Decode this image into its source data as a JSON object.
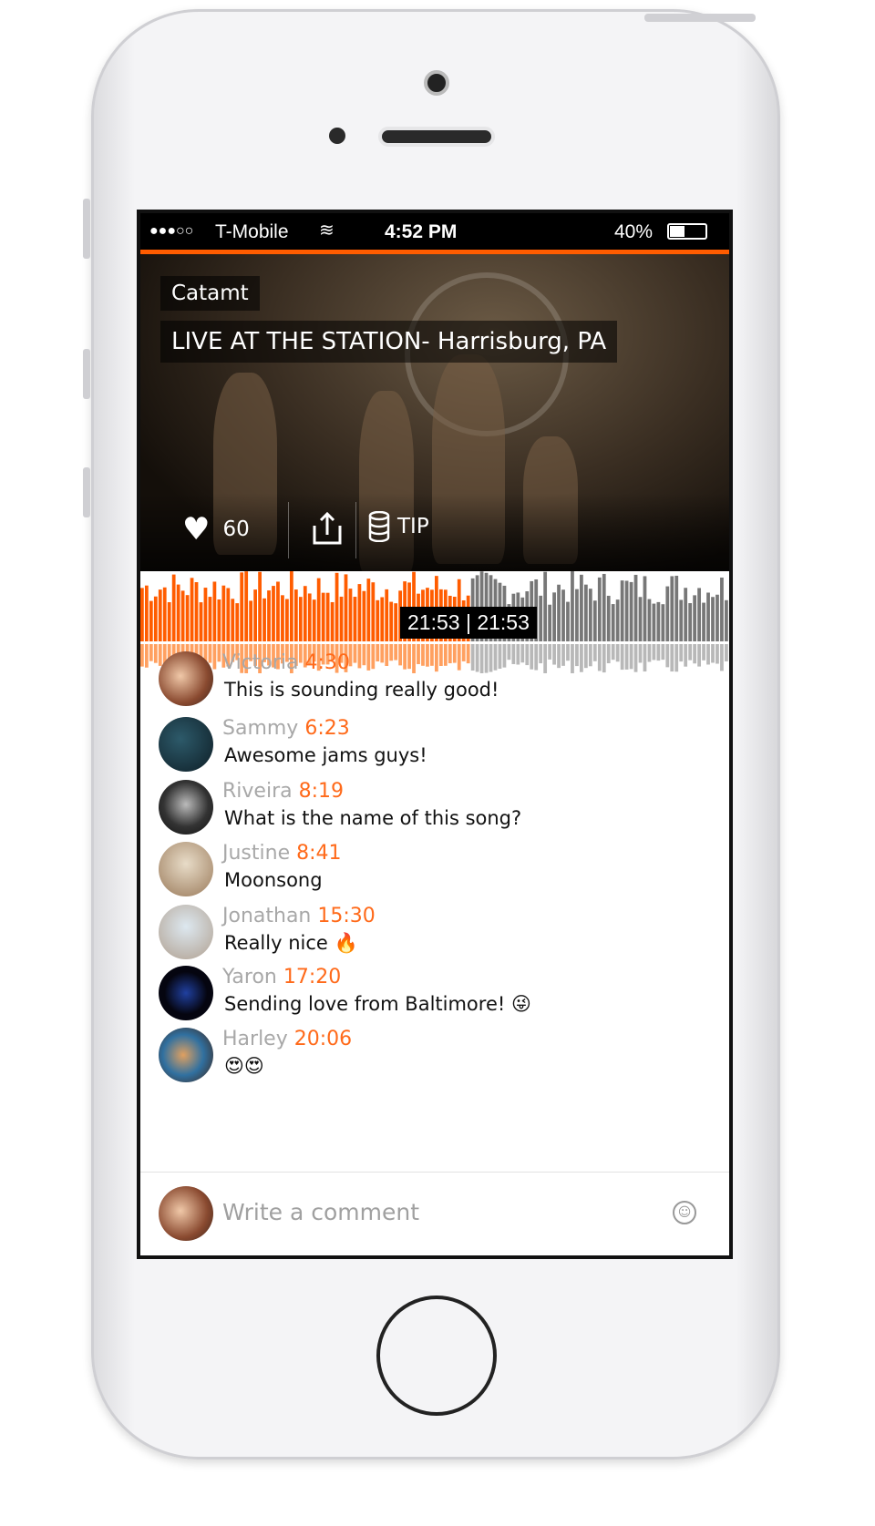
{
  "status_bar": {
    "signal": "●●●○○",
    "carrier": "T-Mobile",
    "time": "4:52 PM",
    "battery": "40%",
    "battery_level": 0.4
  },
  "track": {
    "artist": "Catamt",
    "title": "LIVE AT THE STATION- Harrisburg, PA",
    "likes": "60",
    "tip_label": "TIP"
  },
  "player": {
    "elapsed": "21:53",
    "duration": "21:53",
    "progress": 0.56,
    "played_color": "#ff5c00",
    "unplayed_color": "#777777"
  },
  "comments": [
    {
      "name": "Victoria",
      "time": "4:30",
      "text": "This is sounding really good!"
    },
    {
      "name": "Sammy",
      "time": "6:23",
      "text": "Awesome jams guys!"
    },
    {
      "name": "Riveira",
      "time": "8:19",
      "text": "What is the name of this song?"
    },
    {
      "name": "Justine",
      "time": "8:41",
      "text": "Moonsong"
    },
    {
      "name": "Jonathan",
      "time": "15:30",
      "text": "Really nice 🔥"
    },
    {
      "name": "Yaron",
      "time": "17:20",
      "text": "Sending love from Baltimore! 😜"
    },
    {
      "name": "Harley",
      "time": "20:06",
      "text": "😍😍"
    }
  ],
  "composer": {
    "placeholder": "Write a comment",
    "emoji_icon": "smiley-icon"
  },
  "colors": {
    "accent": "#ff5c00",
    "time": "#ff6a1a"
  }
}
